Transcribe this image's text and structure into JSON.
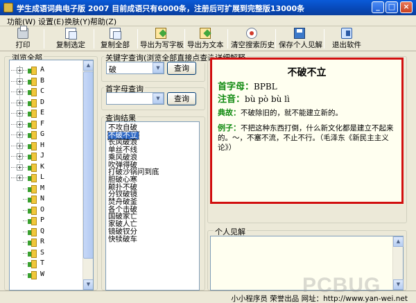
{
  "window": {
    "title": "学生成语词典电子版 2007 目前成语只有6000条，注册后可扩展到完整版13000条",
    "min": "_",
    "max": "□",
    "close": "×"
  },
  "menu": [
    "功能(W)",
    "设置(E)",
    "换肤(Y)",
    "帮助(Z)"
  ],
  "toolbar": {
    "print": "打印",
    "copy_selected": "复制选定",
    "copy_all": "复制全部",
    "export_writing": "导出为写字板",
    "export_text": "导出为文本",
    "clear_history": "清空搜索历史",
    "save_notes": "保存个人见解",
    "exit": "退出软件"
  },
  "browse": {
    "title": "浏览全部",
    "items": [
      "A",
      "B",
      "C",
      "D",
      "E",
      "F",
      "G",
      "H",
      "J",
      "K",
      "L",
      "M",
      "N",
      "O",
      "P",
      "Q",
      "R",
      "S",
      "T",
      "W"
    ]
  },
  "keyword": {
    "title": "关键字查询(浏览全部直接点查询)",
    "value": "破",
    "button": "查询"
  },
  "initial": {
    "title": "首字母查询",
    "value": "",
    "button": "查询"
  },
  "results": {
    "title": "查询结果",
    "items": [
      "不攻自破",
      "不破不立",
      "长风破浪",
      "单丝不线",
      "乘风破浪",
      "吹弹得破",
      "打破沙锅问到底",
      "胆破心寒",
      "颠扑不破",
      "分钗破镜",
      "焚舟破釜",
      "各个击破",
      "国破家亡",
      "家破人亡",
      "镜破钗分",
      "快犊破车"
    ],
    "selected_index": 1
  },
  "detail": {
    "title": "详细解释",
    "idiom": "不破不立",
    "initials_label": "首字母：",
    "initials": "BPBL",
    "pinyin_label": "注音：",
    "pinyin": "bù pò bù lì",
    "origin_label": "典故：",
    "origin": "不破除旧的，就不能建立新的。",
    "example_label": "例子：",
    "example": "不把这种东西打倒，什么新文化都是建立不起来的。～，不塞不流，不止不行。（毛泽东《新民主主义论》）"
  },
  "notes": {
    "title": "个人见解"
  },
  "status": "小小程序员  荣誉出品  网址：http://www.yan-wei.net",
  "watermark": "PCBUG"
}
